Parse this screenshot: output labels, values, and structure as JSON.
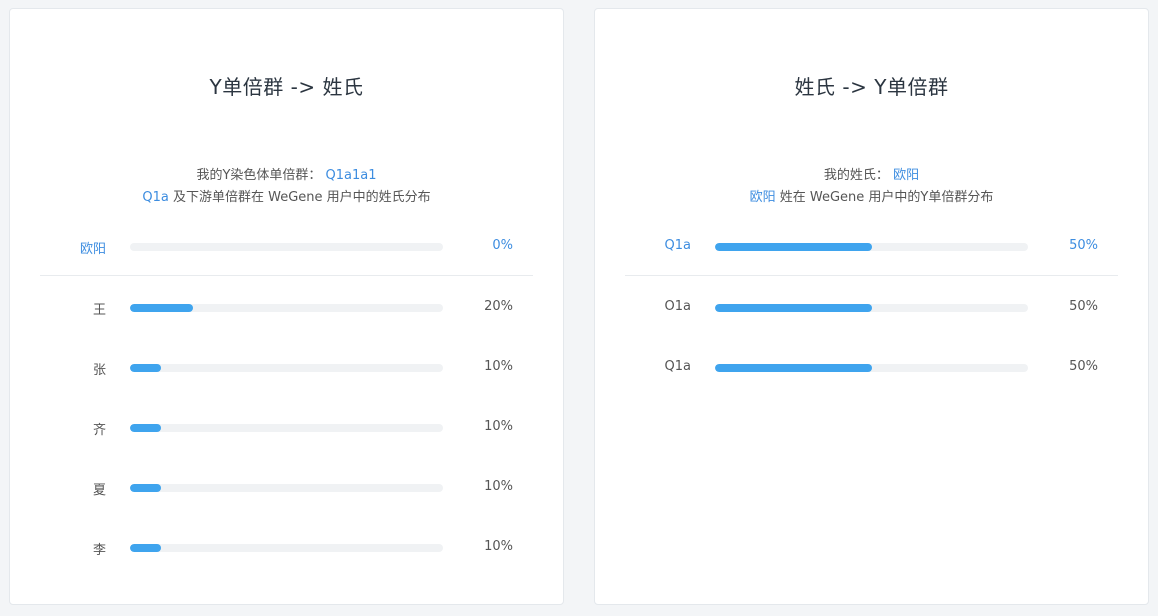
{
  "left_card": {
    "title": "Y单倍群 -> 姓氏",
    "desc_prefix": "我的Y染色体单倍群：",
    "desc_value": "Q1a1a1",
    "desc2_highlight": "Q1a",
    "desc2_rest": " 及下游单倍群在 WeGene 用户中的姓氏分布",
    "highlight_row": {
      "label": "欧阳",
      "value": 0,
      "pct_label": "0%"
    },
    "rows": [
      {
        "label": "王",
        "value": 20,
        "pct_label": "20%"
      },
      {
        "label": "张",
        "value": 10,
        "pct_label": "10%"
      },
      {
        "label": "齐",
        "value": 10,
        "pct_label": "10%"
      },
      {
        "label": "夏",
        "value": 10,
        "pct_label": "10%"
      },
      {
        "label": "李",
        "value": 10,
        "pct_label": "10%"
      }
    ]
  },
  "right_card": {
    "title": "姓氏 -> Y单倍群",
    "desc_prefix": "我的姓氏：",
    "desc_value": "欧阳",
    "desc2_highlight": "欧阳",
    "desc2_rest": " 姓在 WeGene 用户中的Y单倍群分布",
    "highlight_row": {
      "label": "Q1a",
      "value": 50,
      "pct_label": "50%"
    },
    "rows": [
      {
        "label": "O1a",
        "value": 50,
        "pct_label": "50%"
      },
      {
        "label": "Q1a",
        "value": 50,
        "pct_label": "50%"
      }
    ]
  },
  "colors": {
    "accent": "#3d8de0",
    "bar": "#3fa4ee",
    "track": "#f0f2f4"
  }
}
